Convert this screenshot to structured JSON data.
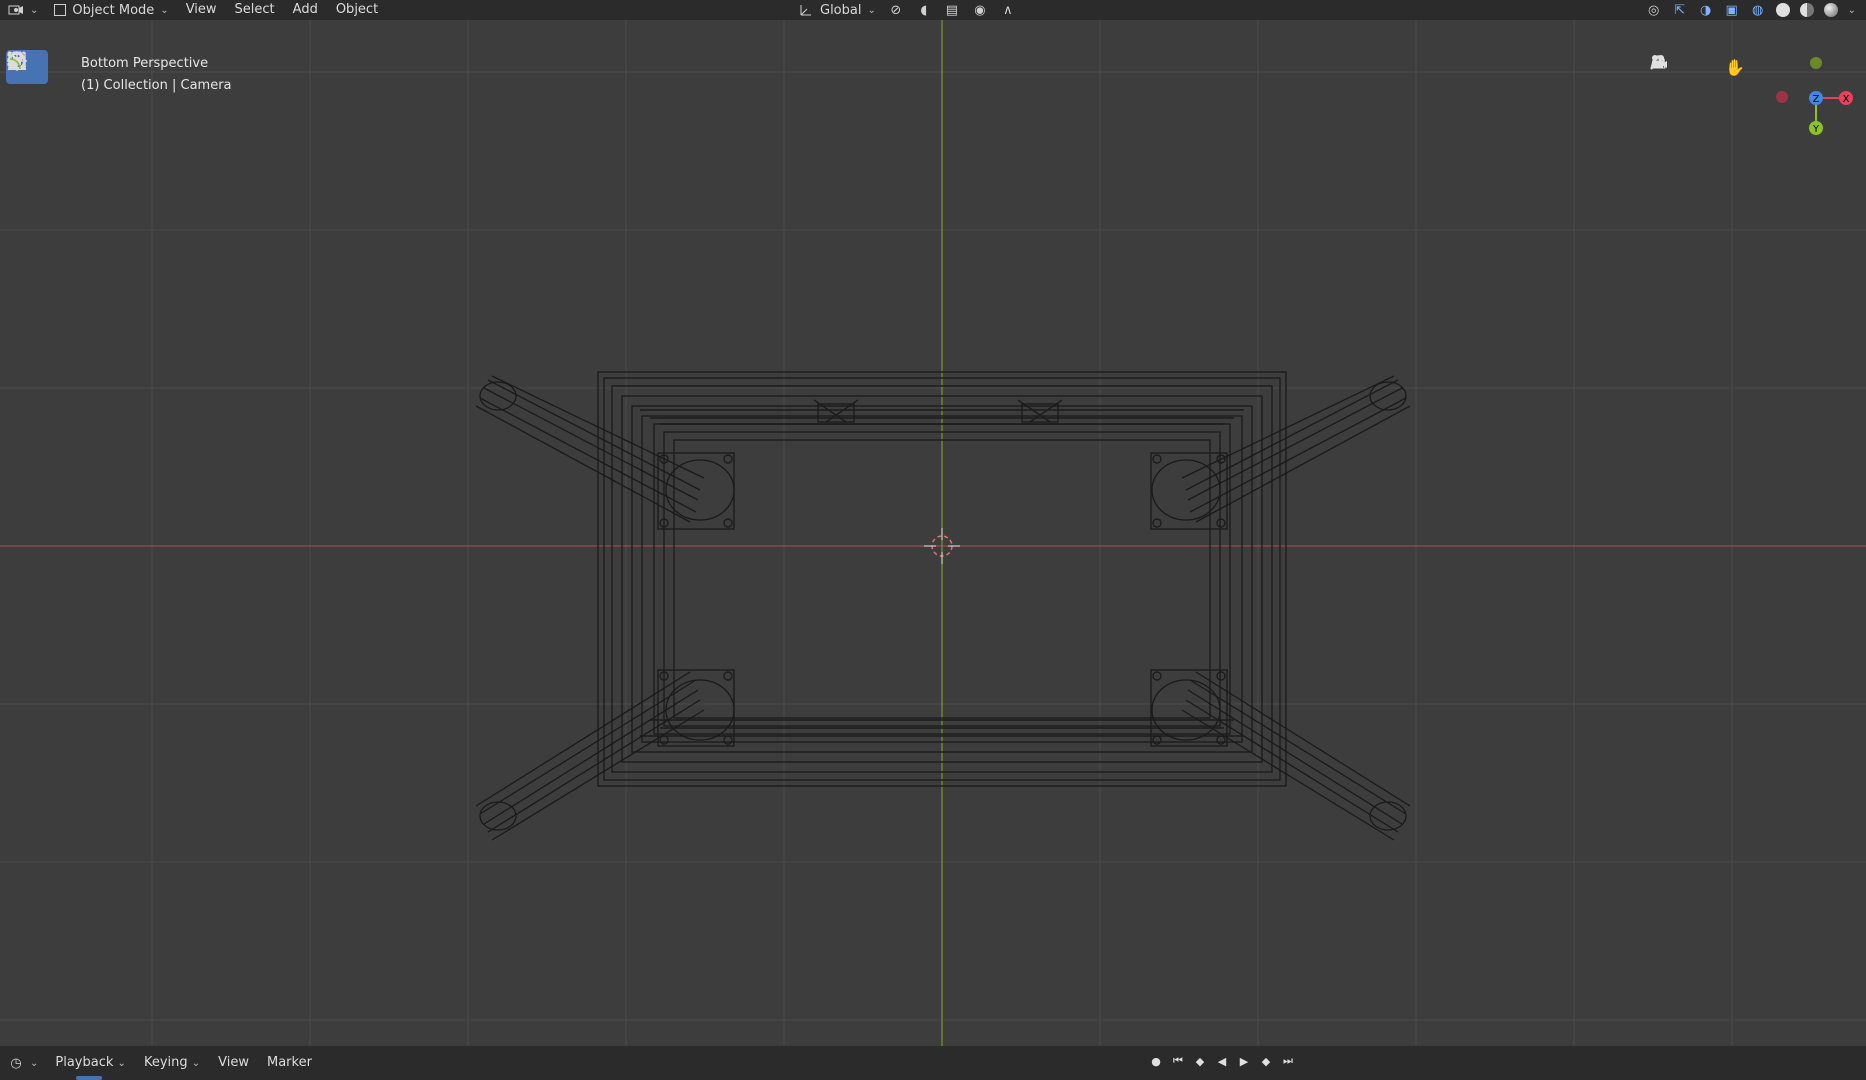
{
  "header": {
    "editor_icon": "viewport-icon",
    "mode_label": "Object Mode",
    "menus": [
      "View",
      "Select",
      "Add",
      "Object"
    ],
    "transform_orientation": "Global"
  },
  "viewport": {
    "view_name": "Bottom Perspective",
    "collection_info": "(1) Collection | Camera",
    "colors": {
      "background": "#3d3d3d",
      "grid": "#4a4a4a",
      "x_axis": "#9b4a56",
      "y_axis": "#7a9a2a",
      "wire": "#1a1a1a",
      "cursor": "#e07070"
    }
  },
  "toolbar": {
    "tools": [
      {
        "name": "select-box-tool",
        "icon": "cursor-select-icon",
        "active": true
      },
      {
        "name": "cursor-tool",
        "icon": "3d-cursor-icon",
        "active": false
      },
      {
        "name": "move-tool",
        "icon": "move-arrows-icon",
        "active": false
      },
      {
        "name": "rotate-tool",
        "icon": "rotate-icon",
        "active": false
      },
      {
        "name": "scale-tool",
        "icon": "scale-icon",
        "active": false
      },
      {
        "name": "transform-tool",
        "icon": "transform-icon",
        "active": false
      },
      {
        "name": "annotate-tool",
        "icon": "annotate-pencil-icon",
        "active": false
      },
      {
        "name": "measure-tool",
        "icon": "measure-ruler-icon",
        "active": false
      }
    ]
  },
  "gizmo": {
    "labels": {
      "x": "X",
      "y": "Y",
      "z": "Z"
    },
    "colors": {
      "x": "#e8425a",
      "y": "#8bc22a",
      "z": "#3d8ae8"
    }
  },
  "timeline": {
    "menus": [
      "Playback",
      "Keying",
      "View",
      "Marker"
    ]
  }
}
